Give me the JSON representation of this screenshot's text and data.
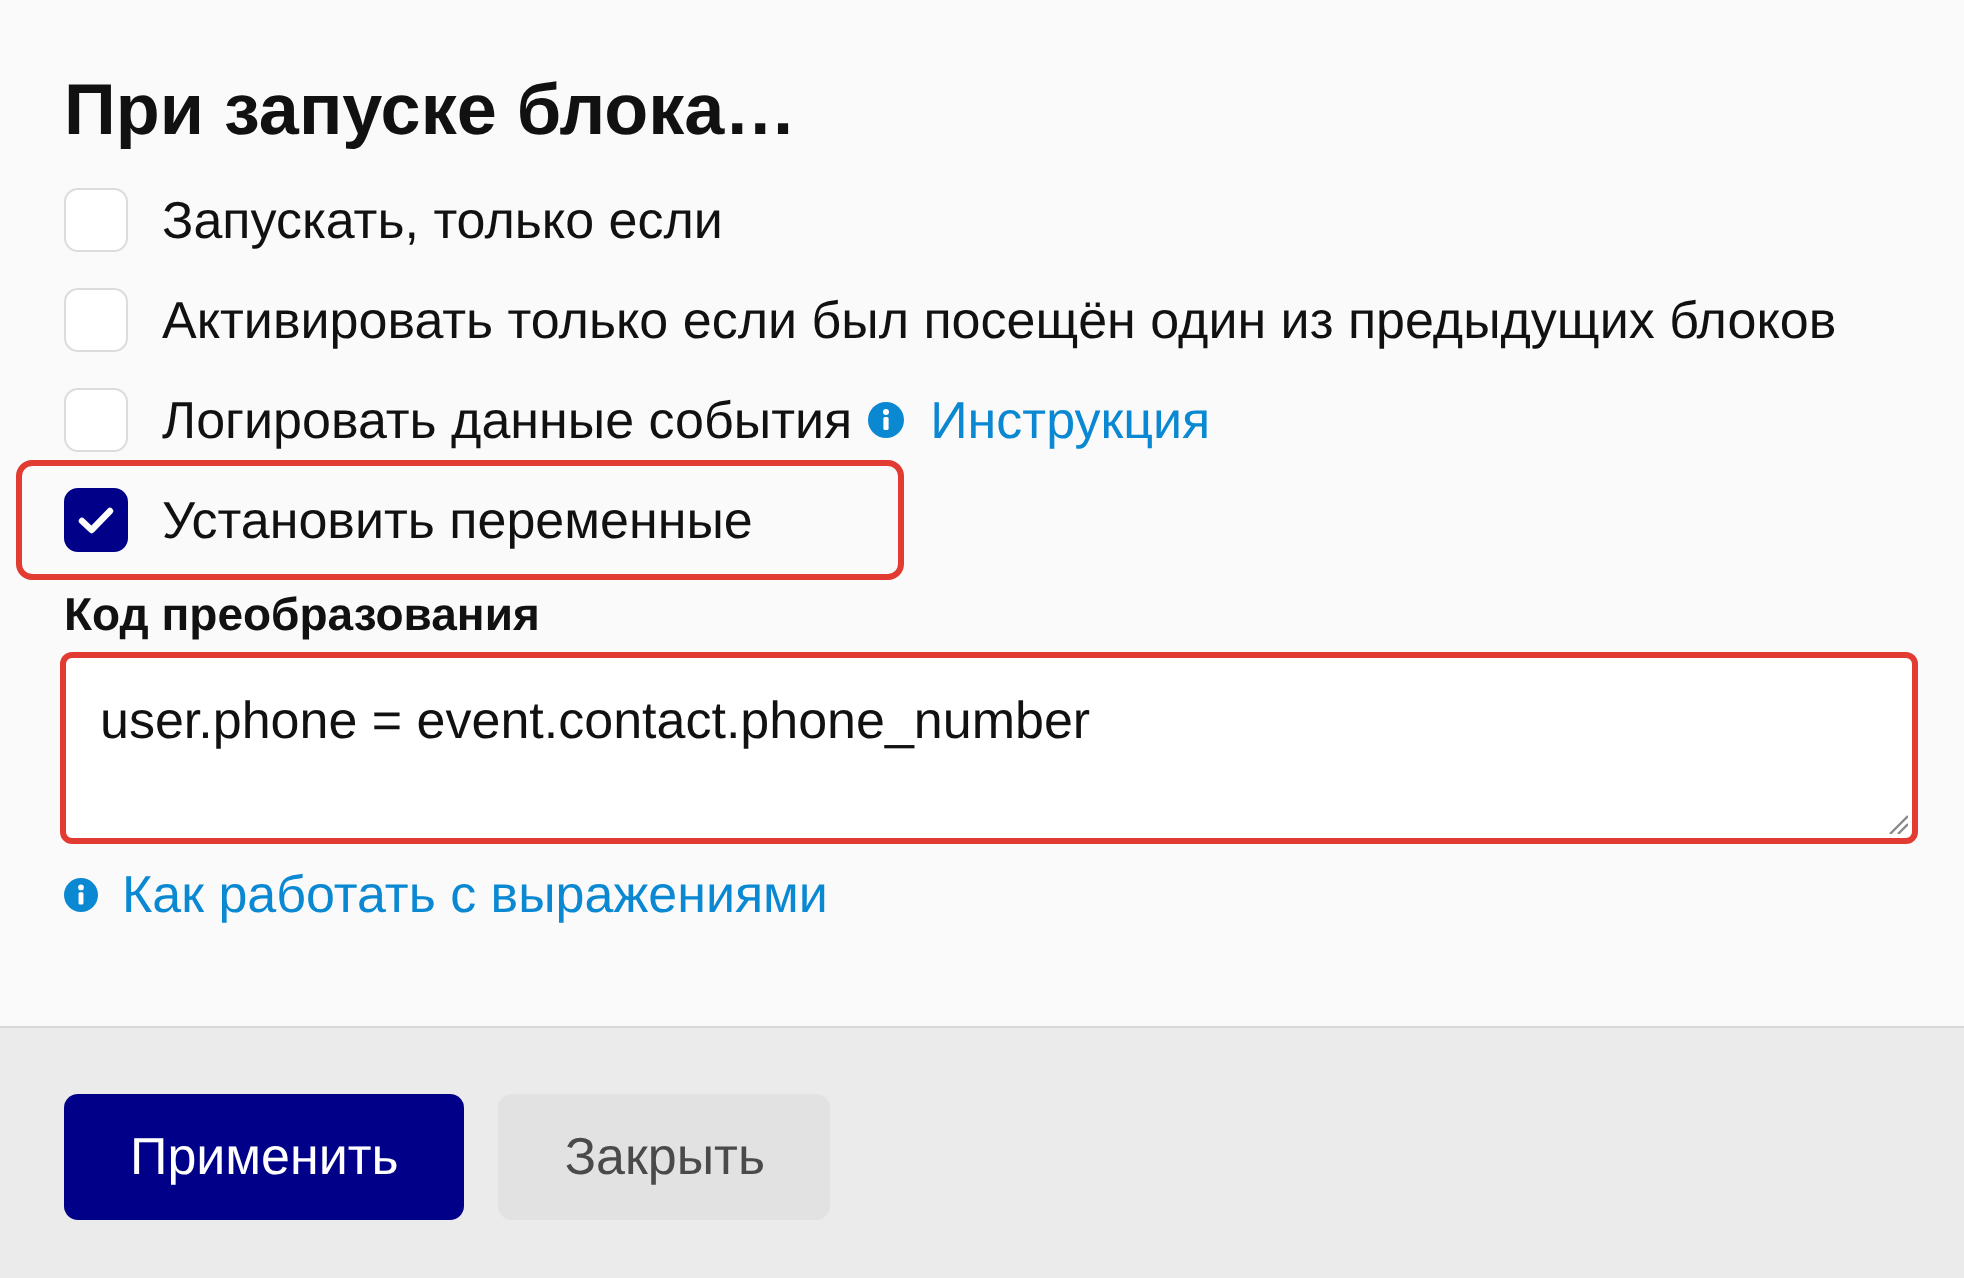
{
  "dialog": {
    "title": "При запуске блока…"
  },
  "options": [
    {
      "label": "Запускать, только если",
      "checked": false,
      "highlighted": false
    },
    {
      "label": "Активировать только если был посещён один из предыдущих блоков",
      "checked": false,
      "highlighted": false
    },
    {
      "label": "Логировать данные события",
      "checked": false,
      "highlighted": false,
      "help_link": "Инструкция"
    },
    {
      "label": "Установить переменные",
      "checked": true,
      "highlighted": true
    }
  ],
  "code_field": {
    "label": "Код преобразования",
    "value": "user.phone = event.contact.phone_number",
    "highlighted": true
  },
  "help_link": "Как работать с выражениями",
  "buttons": [
    {
      "label": "Применить",
      "kind": "primary"
    },
    {
      "label": "Закрыть",
      "kind": "secondary"
    }
  ]
}
